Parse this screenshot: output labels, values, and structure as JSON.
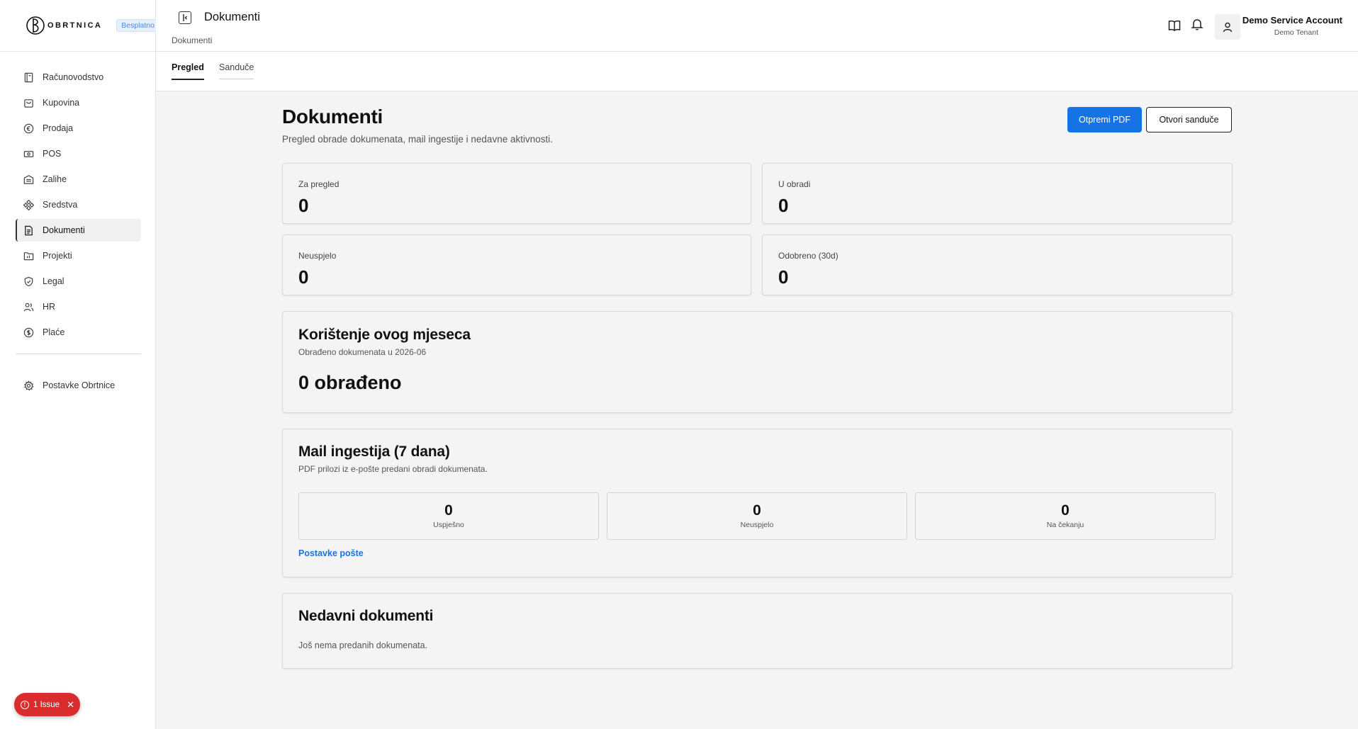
{
  "brand": {
    "name": "OBRTNICA",
    "plan_badge": "Besplatno"
  },
  "sidebar": {
    "items": [
      {
        "label": "Računovodstvo",
        "icon": "ledger-icon"
      },
      {
        "label": "Kupovina",
        "icon": "shopping-bag-icon"
      },
      {
        "label": "Prodaja",
        "icon": "coin-icon"
      },
      {
        "label": "POS",
        "icon": "cash-register-icon"
      },
      {
        "label": "Zalihe",
        "icon": "warehouse-icon"
      },
      {
        "label": "Sredstva",
        "icon": "assets-icon"
      },
      {
        "label": "Dokumenti",
        "icon": "document-icon",
        "active": true
      },
      {
        "label": "Projekti",
        "icon": "folder-chart-icon"
      },
      {
        "label": "Legal",
        "icon": "shield-check-icon"
      },
      {
        "label": "HR",
        "icon": "users-icon"
      },
      {
        "label": "Plaće",
        "icon": "dollar-circle-icon"
      }
    ],
    "settings_label": "Postavke Obrtnice"
  },
  "issue_badge": {
    "label": "1 Issue"
  },
  "header": {
    "title": "Dokumenti",
    "breadcrumb": "Dokumenti",
    "user_name": "Demo Service Account",
    "tenant": "Demo Tenant"
  },
  "tabs": [
    {
      "label": "Pregled",
      "active": true
    },
    {
      "label": "Sandučе",
      "active": false
    }
  ],
  "page": {
    "title": "Dokumenti",
    "subtitle": "Pregled obrade dokumenata, mail ingestije i nedavne aktivnosti.",
    "primary_button": "Otpremi PDF",
    "secondary_button": "Otvori sanduče"
  },
  "stats": [
    {
      "label": "Za pregled",
      "value": "0"
    },
    {
      "label": "U obradi",
      "value": "0"
    },
    {
      "label": "Neuspjelo",
      "value": "0"
    },
    {
      "label": "Odobreno (30d)",
      "value": "0"
    }
  ],
  "usage": {
    "title": "Korištenje ovog mjeseca",
    "subtitle": "Obrađeno dokumenata u 2026-06",
    "metric": "0 obrađeno"
  },
  "mail": {
    "title": "Mail ingestija (7 dana)",
    "subtitle": "PDF prilozi iz e-pošte predani obradi dokumenata.",
    "stats": [
      {
        "value": "0",
        "label": "Uspješno"
      },
      {
        "value": "0",
        "label": "Neuspjelo"
      },
      {
        "value": "0",
        "label": "Na čekanju"
      }
    ],
    "link": "Postavke pošte"
  },
  "recent": {
    "title": "Nedavni dokumenti",
    "empty": "Još nema predanih dokumenata."
  }
}
